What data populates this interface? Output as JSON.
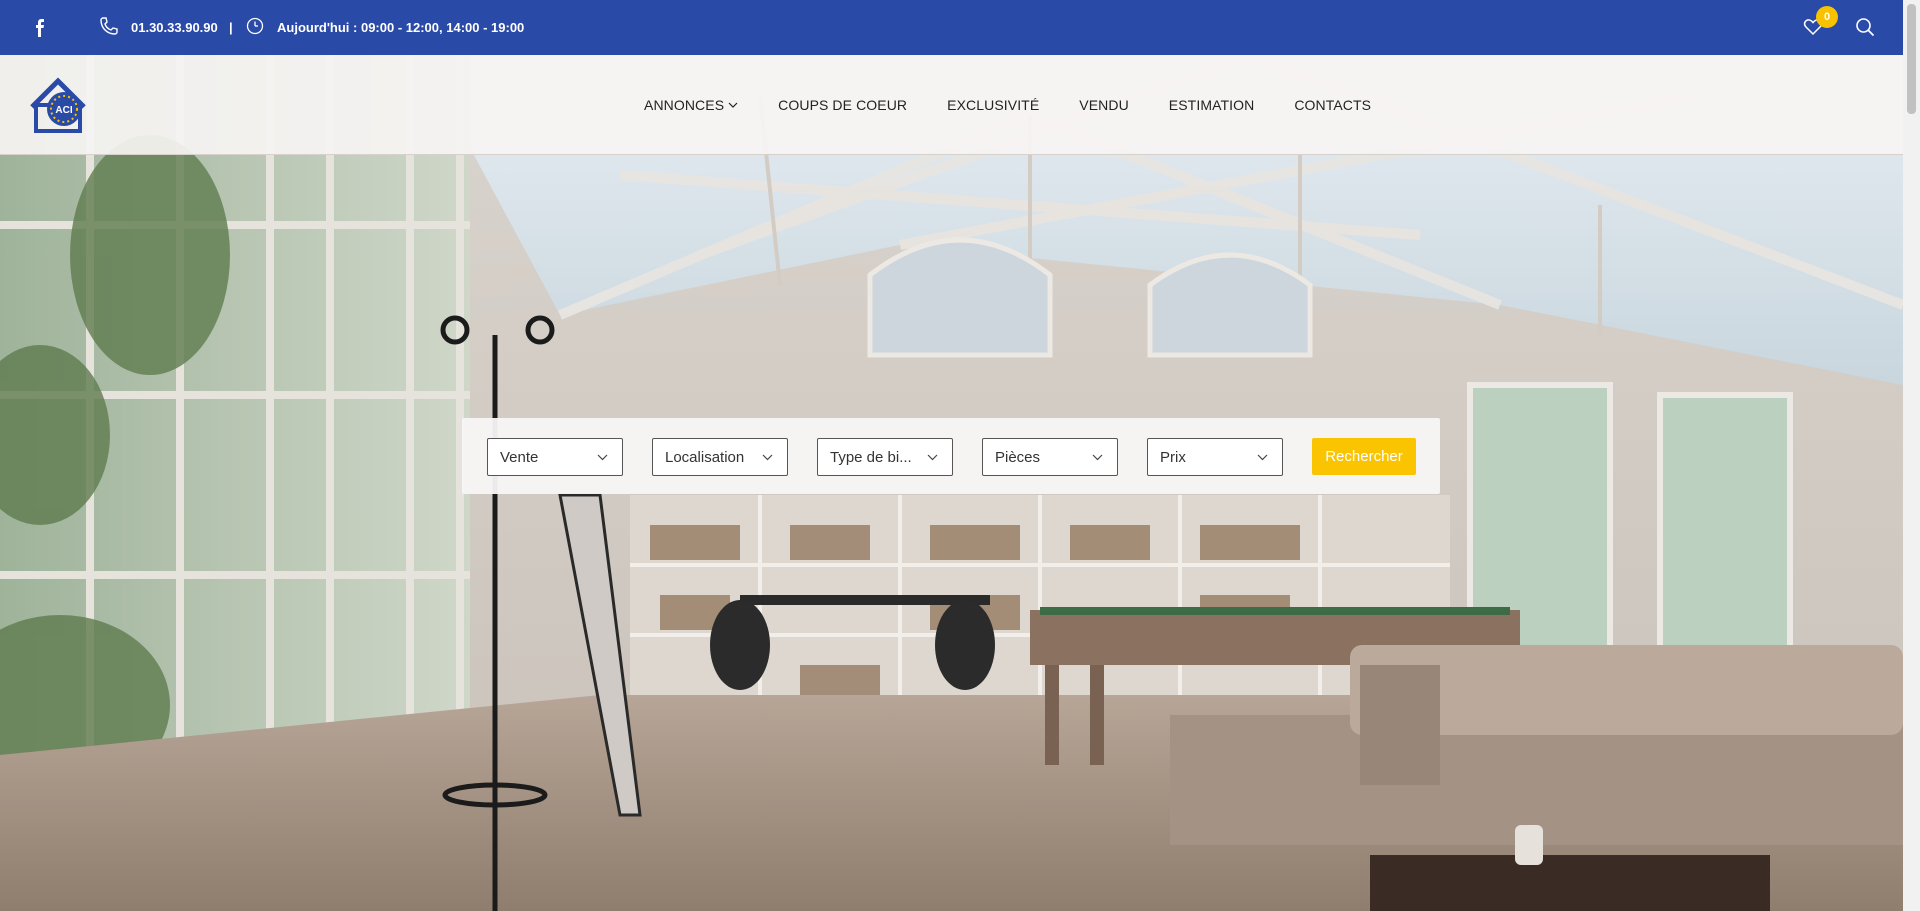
{
  "topbar": {
    "phone": "01.30.33.90.90",
    "separator": "|",
    "hours": "Aujourd'hui : 09:00 - 12:00, 14:00 - 19:00",
    "favorites_count": "0",
    "facebook_icon": "facebook-icon",
    "phone_icon": "phone-icon",
    "clock_icon": "clock-icon",
    "heart_icon": "heart-icon",
    "search_icon": "search-icon",
    "bg_color": "#2a4aa8",
    "badge_color": "#f8c200"
  },
  "logo": {
    "text": "ACI"
  },
  "nav": {
    "items": [
      {
        "label": "ANNONCES",
        "has_dropdown": true
      },
      {
        "label": "COUPS DE COEUR"
      },
      {
        "label": "EXCLUSIVITÉ"
      },
      {
        "label": "VENDU"
      },
      {
        "label": "ESTIMATION"
      },
      {
        "label": "CONTACTS"
      }
    ]
  },
  "search": {
    "filters": [
      {
        "value": "Vente"
      },
      {
        "value": "Localisation"
      },
      {
        "value": "Type de bi..."
      },
      {
        "value": "Pièces"
      },
      {
        "value": "Prix"
      }
    ],
    "button_label": "Rechercher",
    "button_color": "#fbc400"
  }
}
